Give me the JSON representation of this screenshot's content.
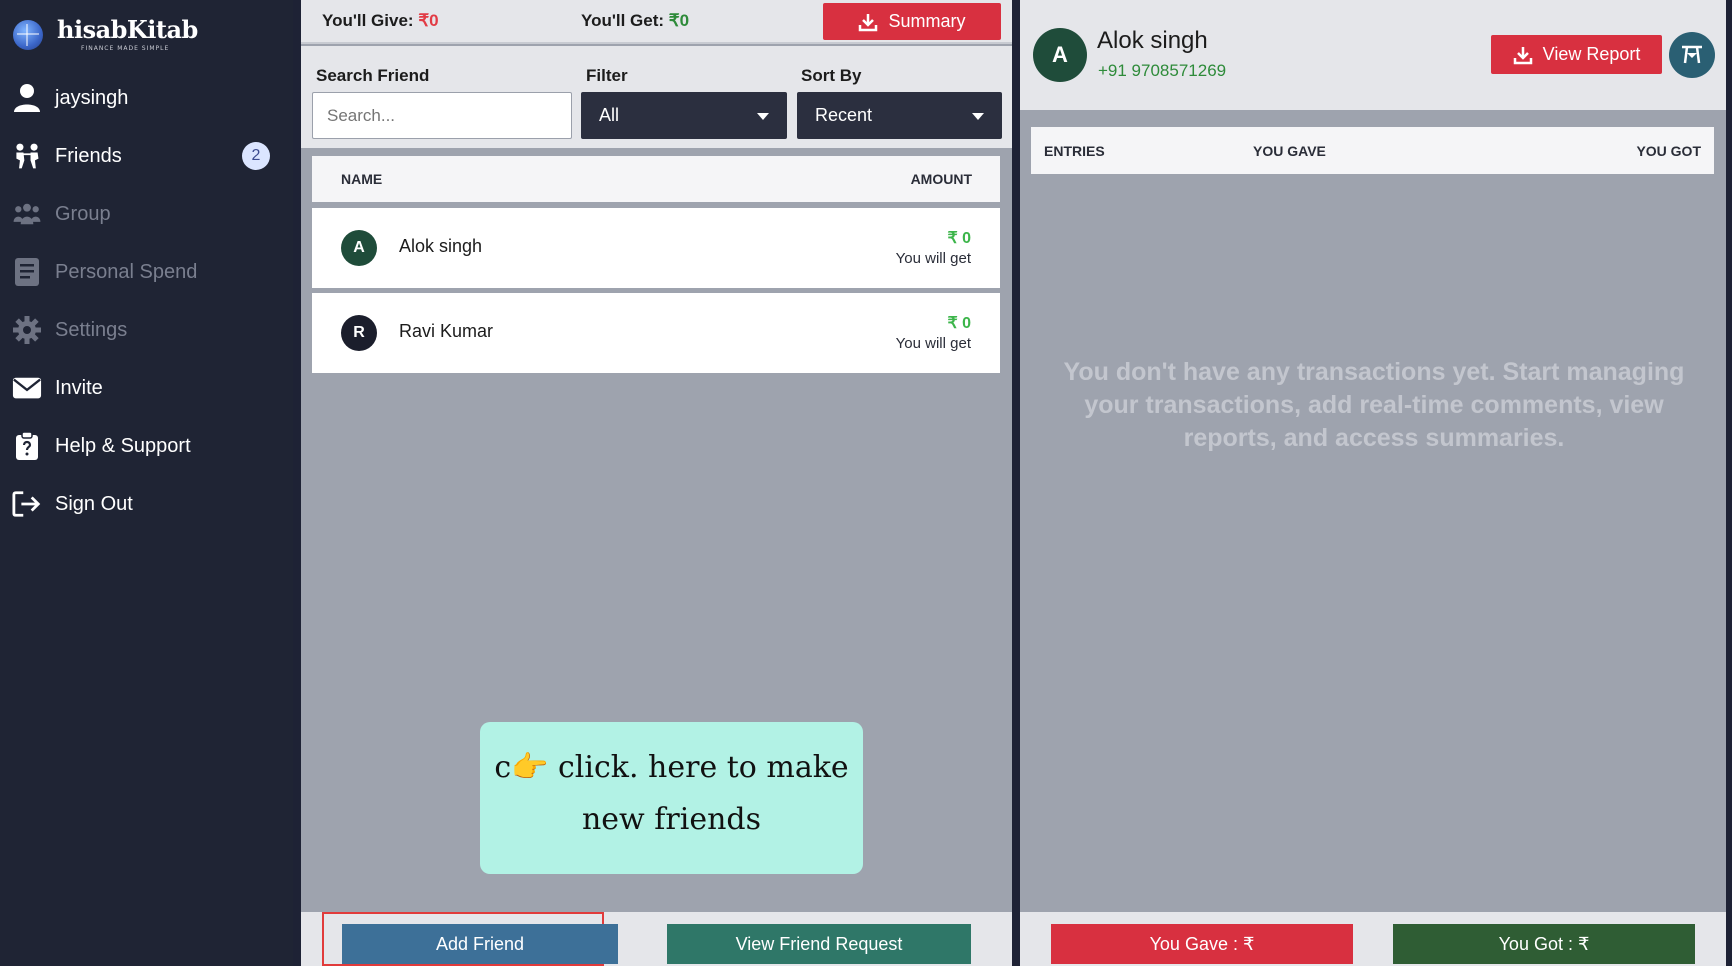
{
  "app": {
    "logo_name": "hisabKitab",
    "logo_tagline": "FINANCE MADE SIMPLE",
    "logo_mark": "₹"
  },
  "sidebar": {
    "items": [
      {
        "label": "jaysingh",
        "icon": "user-icon"
      },
      {
        "label": "Friends",
        "icon": "friends-icon",
        "badge": "2"
      },
      {
        "label": "Group",
        "icon": "group-icon"
      },
      {
        "label": "Personal Spend",
        "icon": "notebook-icon"
      },
      {
        "label": "Settings",
        "icon": "gear-icon"
      },
      {
        "label": "Invite",
        "icon": "envelope-icon"
      },
      {
        "label": "Help & Support",
        "icon": "help-clipboard-icon"
      },
      {
        "label": "Sign Out",
        "icon": "sign-out-icon"
      }
    ]
  },
  "summary_bar": {
    "give_label": "You'll Give:",
    "give_value": "₹0",
    "get_label": "You'll Get:",
    "get_value": "₹0",
    "summary_button": "Summary"
  },
  "filters": {
    "search_label": "Search Friend",
    "search_placeholder": "Search...",
    "filter_label": "Filter",
    "filter_value": "All",
    "sort_label": "Sort By",
    "sort_value": "Recent"
  },
  "friends_list": {
    "header_name": "NAME",
    "header_amount": "AMOUNT",
    "rows": [
      {
        "initial": "A",
        "name": "Alok singh",
        "amount": "₹ 0",
        "note": "You will get",
        "avatar_color": "#1f4c3a"
      },
      {
        "initial": "R",
        "name": "Ravi Kumar",
        "amount": "₹ 0",
        "note": "You will get",
        "avatar_color": "#1b1e2c"
      }
    ]
  },
  "tooltip": {
    "line1": "c👉 click. here to make",
    "line2": "new friends"
  },
  "bottom_actions": {
    "add_friend": "Add Friend",
    "view_requests": "View Friend Request"
  },
  "detail": {
    "initial": "A",
    "name": "Alok singh",
    "phone": "+91 9708571269",
    "view_report": "View Report",
    "headers": {
      "entries": "ENTRIES",
      "gave": "YOU GAVE",
      "got": "YOU GOT"
    },
    "empty_message": "You don't have any transactions yet. Start managing your transactions, add real-time comments, view reports, and access summaries.",
    "you_gave_button": "You Gave : ₹",
    "you_got_button": "You Got : ₹"
  },
  "colors": {
    "sidebar_bg": "#1f2434",
    "accent_red": "#d83040",
    "accent_green": "#2e8b3a",
    "add_friend_blue": "#3d7098",
    "view_request_teal": "#2f7768",
    "tooltip_bg": "#b2f2e5"
  }
}
